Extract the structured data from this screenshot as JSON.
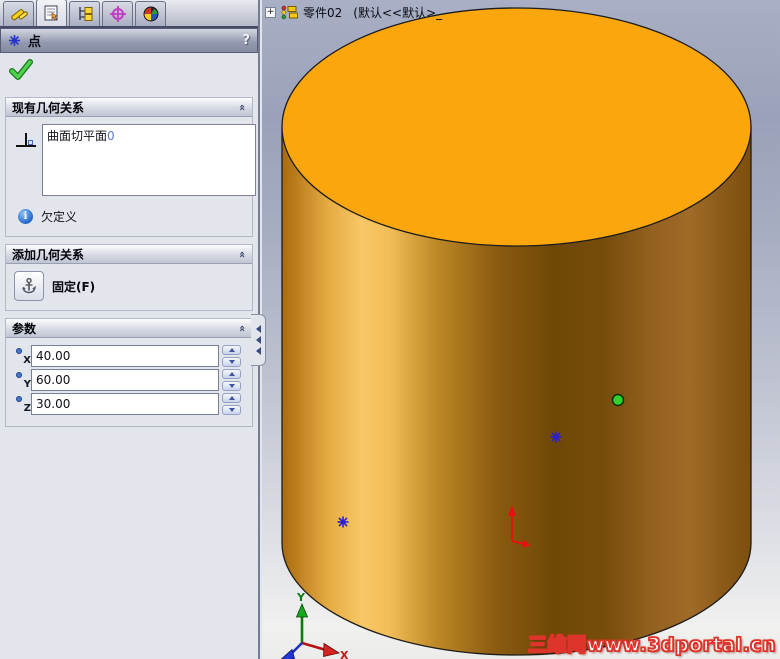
{
  "panel": {
    "tabs": [
      {
        "name": "feature-manager"
      },
      {
        "name": "property-manager",
        "active": true
      },
      {
        "name": "configuration-manager"
      },
      {
        "name": "dimxpert-manager"
      },
      {
        "name": "display-manager"
      }
    ],
    "header": {
      "title": "点",
      "help": "?"
    },
    "existing_relations": {
      "title": "现有几何关系",
      "item": {
        "text": "曲面切平面",
        "index": "0"
      },
      "status": "欠定义"
    },
    "add_relations": {
      "title": "添加几何关系",
      "fix_label": "固定(F)"
    },
    "parameters": {
      "title": "参数",
      "fields": [
        {
          "axis": "X",
          "value": "40.00"
        },
        {
          "axis": "Y",
          "value": "60.00"
        },
        {
          "axis": "Z",
          "value": "30.00"
        }
      ]
    }
  },
  "viewport": {
    "tree": {
      "expand": "+",
      "part_name": "零件02",
      "config": "(默认<<默认>_"
    },
    "triad": {
      "x_label": "X",
      "y_label": "Y"
    },
    "watermark": "三维网www.3dportal.cn"
  },
  "colors": {
    "cylinder_orange": "#fba60d",
    "body_dark_brown": "#6f4806",
    "selected_point_green": "#2fd12f",
    "point_blue": "#2a1fd0",
    "origin_red": "#e81010",
    "watermark_red": "#dd352b"
  }
}
